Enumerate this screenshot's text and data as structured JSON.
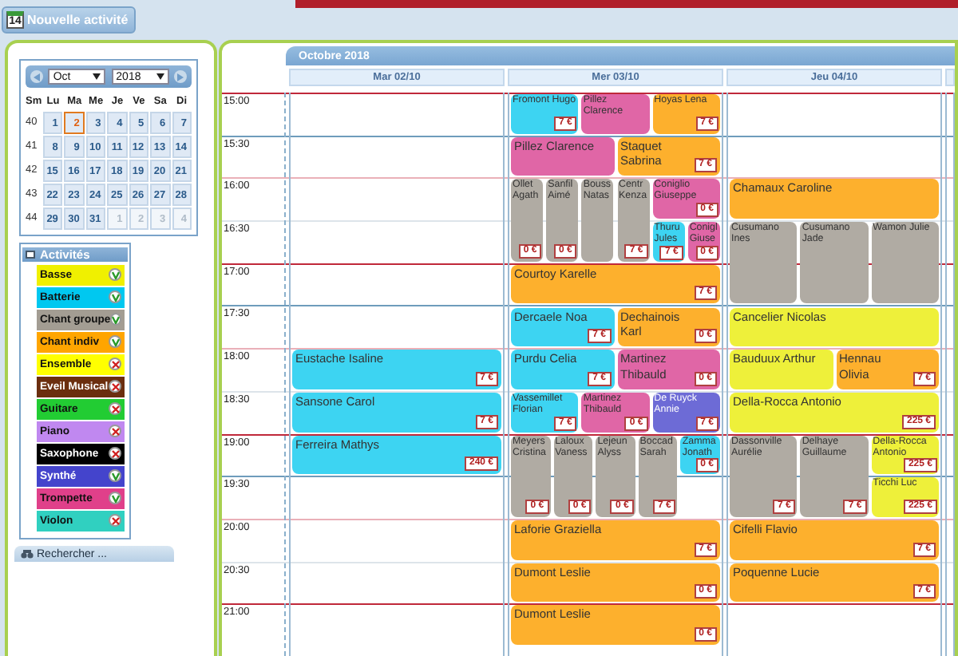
{
  "top_button": {
    "label": "Nouvelle activité",
    "icon_text": "14"
  },
  "mini_calendar": {
    "month": "Oct",
    "year": "2018",
    "weekdays": [
      "Sm",
      "Lu",
      "Ma",
      "Me",
      "Je",
      "Ve",
      "Sa",
      "Di"
    ],
    "weeks": [
      {
        "number": "40",
        "days": [
          {
            "d": "1",
            "other": false,
            "today": false
          },
          {
            "d": "2",
            "other": false,
            "today": true
          },
          {
            "d": "3",
            "other": false,
            "today": false
          },
          {
            "d": "4",
            "other": false,
            "today": false
          },
          {
            "d": "5",
            "other": false,
            "today": false
          },
          {
            "d": "6",
            "other": false,
            "today": false
          },
          {
            "d": "7",
            "other": false,
            "today": false
          }
        ]
      },
      {
        "number": "41",
        "days": [
          {
            "d": "8",
            "other": false,
            "today": false
          },
          {
            "d": "9",
            "other": false,
            "today": false
          },
          {
            "d": "10",
            "other": false,
            "today": false
          },
          {
            "d": "11",
            "other": false,
            "today": false
          },
          {
            "d": "12",
            "other": false,
            "today": false
          },
          {
            "d": "13",
            "other": false,
            "today": false
          },
          {
            "d": "14",
            "other": false,
            "today": false
          }
        ]
      },
      {
        "number": "42",
        "days": [
          {
            "d": "15",
            "other": false,
            "today": false
          },
          {
            "d": "16",
            "other": false,
            "today": false
          },
          {
            "d": "17",
            "other": false,
            "today": false
          },
          {
            "d": "18",
            "other": false,
            "today": false
          },
          {
            "d": "19",
            "other": false,
            "today": false
          },
          {
            "d": "20",
            "other": false,
            "today": false
          },
          {
            "d": "21",
            "other": false,
            "today": false
          }
        ]
      },
      {
        "number": "43",
        "days": [
          {
            "d": "22",
            "other": false,
            "today": false
          },
          {
            "d": "23",
            "other": false,
            "today": false
          },
          {
            "d": "24",
            "other": false,
            "today": false
          },
          {
            "d": "25",
            "other": false,
            "today": false
          },
          {
            "d": "26",
            "other": false,
            "today": false
          },
          {
            "d": "27",
            "other": false,
            "today": false
          },
          {
            "d": "28",
            "other": false,
            "today": false
          }
        ]
      },
      {
        "number": "44",
        "days": [
          {
            "d": "29",
            "other": false,
            "today": false
          },
          {
            "d": "30",
            "other": false,
            "today": false
          },
          {
            "d": "31",
            "other": false,
            "today": false
          },
          {
            "d": "1",
            "other": true,
            "today": false
          },
          {
            "d": "2",
            "other": true,
            "today": false
          },
          {
            "d": "3",
            "other": true,
            "today": false
          },
          {
            "d": "4",
            "other": true,
            "today": false
          }
        ]
      }
    ]
  },
  "activities": {
    "title": "Activités",
    "items": [
      {
        "name": "Basse",
        "color": "#f0f000",
        "enabled": true
      },
      {
        "name": "Batterie",
        "color": "#00c8f0",
        "enabled": true
      },
      {
        "name": "Chant groupe",
        "color": "#a39d93",
        "enabled": true
      },
      {
        "name": "Chant indiv",
        "color": "#ffa500",
        "enabled": true
      },
      {
        "name": "Ensemble",
        "color": "#ffff00",
        "enabled": false
      },
      {
        "name": "Eveil Musical",
        "color": "#6b2e0e",
        "enabled": false
      },
      {
        "name": "Guitare",
        "color": "#22cc33",
        "enabled": false
      },
      {
        "name": "Piano",
        "color": "#c088f0",
        "enabled": false
      },
      {
        "name": "Saxophone",
        "color": "#000000",
        "enabled": false
      },
      {
        "name": "Synthé",
        "color": "#4444cc",
        "enabled": true
      },
      {
        "name": "Trompette",
        "color": "#e0408a",
        "enabled": true
      },
      {
        "name": "Violon",
        "color": "#30d0c0",
        "enabled": false
      }
    ]
  },
  "search": {
    "label": "Rechercher ..."
  },
  "calendar": {
    "title": "Octobre 2018",
    "times": [
      "15:00",
      "15:30",
      "16:00",
      "16:30",
      "17:00",
      "17:30",
      "18:00",
      "18:30",
      "19:00",
      "19:30",
      "20:00",
      "20:30",
      "21:00"
    ],
    "days": [
      {
        "label": "Mar 02/10",
        "slots": [
          {
            "kind": "free"
          },
          {
            "kind": "free"
          },
          {
            "kind": "free"
          },
          {
            "kind": "free"
          },
          {
            "kind": "free"
          },
          {
            "kind": "free"
          },
          {
            "name": "Eustache Isaline",
            "price": "7 €",
            "color": "#3dd4f2",
            "kind": "half"
          },
          {
            "name": "Sansone Carol",
            "price": "7 €",
            "color": "#3dd4f2",
            "kind": "half"
          },
          {
            "name": "Ferreira Mathys",
            "price": "240 €",
            "color": "#3dd4f2",
            "kind": "half"
          }
        ]
      },
      {
        "label": "Mer 03/10",
        "slots": [
          {
            "columns": [
              [
                {
                  "name": "Fromont Hugo",
                  "price": "7 €",
                  "color": "#3dd4f2",
                  "kind": "half"
                }
              ],
              [
                {
                  "name": "Pillez Clarence",
                  "color": "#e066a6",
                  "kind": "half"
                }
              ],
              [
                {
                  "name": "Hoyas Lena",
                  "price": "7 €",
                  "color": "#fdb02d",
                  "kind": "half"
                }
              ]
            ]
          },
          {
            "columns": [
              [
                {
                  "name": "Pillez Clarence",
                  "color": "#e066a6",
                  "kind": "half"
                }
              ],
              [
                {
                  "name": "Staquet Sabrina",
                  "price": "7 €",
                  "color": "#fdb02d",
                  "kind": "half"
                }
              ]
            ]
          },
          {
            "columns": [
              [
                {
                  "name": "Ollet Agath",
                  "price": "0 €",
                  "color": "#b0aba3",
                  "kind": "hour"
                }
              ],
              [
                {
                  "name": "Sanfil Aimé",
                  "price": "0 €",
                  "color": "#b0aba3",
                  "kind": "hour"
                }
              ],
              [
                {
                  "name": "Bouss Natas",
                  "color": "#b0aba3",
                  "kind": "hour"
                }
              ],
              [
                {
                  "name": "Centr Kenza",
                  "price": "7 €",
                  "color": "#b0aba3",
                  "kind": "hour"
                }
              ],
              [
                {
                  "name": "Coniglio Giuseppe",
                  "price": "0 €",
                  "color": "#e066a6",
                  "kind": "half"
                },
                {
                  "columns": [
                    [
                      {
                        "name": "Thuru Jules",
                        "price": "7 €",
                        "color": "#3dd4f2",
                        "kind": "half"
                      }
                    ],
                    [
                      {
                        "name": "Conigl Giuse",
                        "price": "0 €",
                        "color": "#e066a6",
                        "kind": "half"
                      }
                    ]
                  ]
                }
              ]
            ]
          },
          {
            "name": "Courtoy Karelle",
            "price": "7 €",
            "color": "#fdb02d",
            "kind": "half"
          },
          {
            "columns": [
              [
                {
                  "name": "Dercaele Noa",
                  "price": "7 €",
                  "color": "#3dd4f2",
                  "kind": "half"
                }
              ],
              [
                {
                  "name": "Dechainois Karl",
                  "price": "0 €",
                  "color": "#fdb02d",
                  "kind": "half"
                }
              ]
            ]
          },
          {
            "columns": [
              [
                {
                  "name": "Purdu Celia",
                  "price": "7 €",
                  "color": "#3dd4f2",
                  "kind": "half"
                }
              ],
              [
                {
                  "name": "Martinez Thibauld",
                  "price": "0 €",
                  "color": "#e066a6",
                  "kind": "half"
                }
              ]
            ]
          },
          {
            "columns": [
              [
                {
                  "name": "Vassemillet Florian",
                  "price": "7 €",
                  "color": "#3dd4f2",
                  "kind": "half"
                }
              ],
              [
                {
                  "name": "Martinez Thibauld",
                  "price": "0 €",
                  "color": "#e066a6",
                  "kind": "half"
                }
              ],
              [
                {
                  "name": "De Ruyck Annie",
                  "price": "7 €",
                  "color": "#6d6bd6",
                  "kind": "half"
                }
              ]
            ]
          },
          {
            "columns": [
              [
                {
                  "name": "Meyers Cristina",
                  "price": "0 €",
                  "color": "#b0aba3",
                  "kind": "hour"
                }
              ],
              [
                {
                  "name": "Laloux Vaness",
                  "price": "0 €",
                  "color": "#b0aba3",
                  "kind": "hour"
                }
              ],
              [
                {
                  "name": "Lejeun Alyss",
                  "price": "0 €",
                  "color": "#b0aba3",
                  "kind": "hour"
                }
              ],
              [
                {
                  "name": "Boccad Sarah",
                  "price": "7 €",
                  "color": "#b0aba3",
                  "kind": "hour"
                }
              ],
              [
                {
                  "name": "Zamma Jonath",
                  "price": "0 €",
                  "color": "#3dd4f2",
                  "kind": "half"
                }
              ]
            ]
          },
          {
            "name": "Laforie Graziella",
            "price": "7 €",
            "color": "#fdb02d",
            "kind": "half"
          },
          {
            "name": "Dumont Leslie",
            "price": "0 €",
            "color": "#fdb02d",
            "kind": "half"
          },
          {
            "name": "Dumont Leslie",
            "price": "0 €",
            "color": "#fdb02d",
            "kind": "half"
          }
        ]
      },
      {
        "label": "Jeu 04/10",
        "slots": [
          {
            "kind": "free"
          },
          {
            "kind": "free"
          },
          {
            "name": "Chamaux Caroline",
            "color": "#fdb02d",
            "kind": "half"
          },
          {
            "columns": [
              [
                {
                  "name": "Cusumano Ines",
                  "color": "#b0aba3",
                  "kind": "hour"
                }
              ],
              [
                {
                  "name": "Cusumano Jade",
                  "color": "#b0aba3",
                  "kind": "hour"
                }
              ],
              [
                {
                  "name": "Wamon Julie",
                  "color": "#b0aba3",
                  "kind": "hour"
                }
              ]
            ]
          },
          {
            "name": "Cancelier Nicolas",
            "color": "#eef03a",
            "kind": "half"
          },
          {
            "columns": [
              [
                {
                  "name": "Bauduux Arthur",
                  "color": "#eef03a",
                  "kind": "half"
                }
              ],
              [
                {
                  "name": "Hennau Olivia",
                  "price": "7 €",
                  "color": "#fdb02d",
                  "kind": "half"
                }
              ]
            ]
          },
          {
            "name": "Della-Rocca Antonio",
            "price": "225 €",
            "color": "#eef03a",
            "kind": "half"
          },
          {
            "columns": [
              [
                {
                  "name": "Dassonville Aurélie",
                  "price": "7 €",
                  "color": "#b0aba3",
                  "kind": "hour"
                }
              ],
              [
                {
                  "name": "Delhaye Guillaume",
                  "price": "7 €",
                  "color": "#b0aba3",
                  "kind": "hour"
                }
              ],
              [
                {
                  "name": "Della-Rocca Antonio",
                  "price": "225 €",
                  "color": "#eef03a",
                  "kind": "half"
                },
                {
                  "name": "Ticchi Luc",
                  "price": "225 €",
                  "color": "#eef03a",
                  "kind": "half"
                }
              ]
            ]
          },
          {
            "name": "Cifelli Flavio",
            "price": "7 €",
            "color": "#fdb02d",
            "kind": "half"
          },
          {
            "name": "Poquenne Lucie",
            "price": "7 €",
            "color": "#fdb02d",
            "kind": "half"
          }
        ]
      }
    ]
  }
}
